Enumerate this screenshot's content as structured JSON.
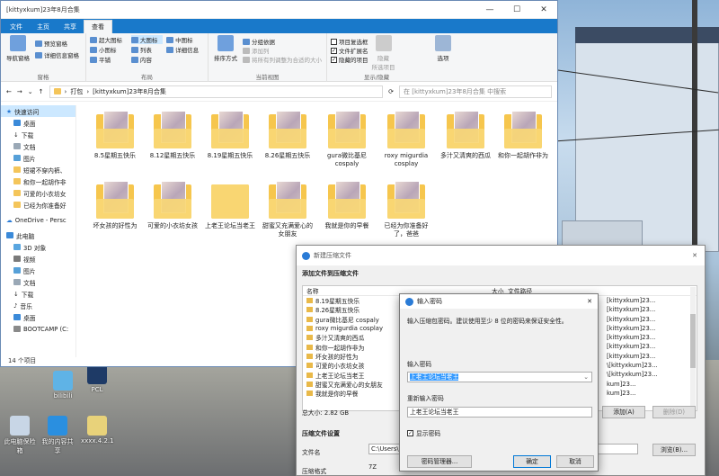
{
  "explorer": {
    "title": "[kittyxkum]23年8月合集",
    "tabs": [
      "文件",
      "主页",
      "共享",
      "查看"
    ],
    "ribbon": {
      "pane": {
        "nav_pane": "导航窗格",
        "preview": "预览窗格",
        "details": "详细信息窗格",
        "label": "窗格"
      },
      "layout": {
        "items": [
          "超大图标",
          "大图标",
          "中图标",
          "小图标",
          "列表",
          "详细信息",
          "平铺",
          "内容"
        ],
        "label": "布局"
      },
      "view": {
        "sort": "排序方式",
        "group": "分组依据",
        "add_column": "添加列",
        "fit_columns": "将所有列调整为合适的大小",
        "label": "当前视图"
      },
      "showhide": {
        "item_checkbox": "项目复选框",
        "extensions": "文件扩展名",
        "hidden_items": "隐藏的项目",
        "hide_selected": "隐藏\n所选项目",
        "options": "选项",
        "label": "显示/隐藏"
      }
    },
    "address": {
      "crumbs": [
        "打包",
        "[kittyxkum]23年8月合集"
      ],
      "search_placeholder": "在 [kittyxkum]23年8月合集 中搜索"
    },
    "nav": [
      "快速访问",
      "桌面",
      "下载",
      "文档",
      "图片",
      "短裙不穿内裤、",
      "和你一起胡作非",
      "可爱的小衣坊女",
      "已经为你准备好",
      "OneDrive - Persc",
      "此电脑",
      "3D 对象",
      "视频",
      "图片",
      "文档",
      "下载",
      "音乐",
      "桌面",
      "BOOTCAMP (C:"
    ],
    "folders": [
      "8.5星期五快乐",
      "8.12星期五快乐",
      "8.19星期五快乐",
      "8.26星期五快乐",
      "gura微比基尼cospaly",
      "roxy migurdia cosplay",
      "多汁又清爽的西瓜",
      "和你一起胡作非为",
      "坏女孩的好性为",
      "可爱的小衣坊女孩",
      "上老王论坛当老王",
      "甜蜜又充满爱心的女朋友",
      "我就是你的早餐",
      "已经为你准备好了，爸爸"
    ],
    "status": "14 个项目"
  },
  "desktop_icons": [
    "PCL",
    "bilibili",
    "此电脑保险箱",
    "我的内容共享",
    "xxxx.4.2.1"
  ],
  "compress": {
    "title": "新建压缩文件",
    "section_add": "添加文件到压缩文件",
    "col_name": "名称",
    "col_size": "大小",
    "col_path": "文件路径",
    "files": [
      "8.19星期五快乐",
      "8.26星期五快乐",
      "gura微比基尼 cospaly",
      "roxy migurdia cosplay",
      "多汁又清爽的西瓜",
      "和你一起胡作非为",
      "坏女孩的好性为",
      "可爱的小衣坊女孩",
      "上老王论坛当老王",
      "甜蜜又充满爱心的女朋友",
      "我就是你的早餐"
    ],
    "path_prefix": "[kittyxkum]23...",
    "path_stub": "\\[kittyxkum]23...",
    "path_partial": "kum]23...",
    "total_size": "总大小: 2.82 GB",
    "add_btn": "添加(A)",
    "delete_btn": "删除(D)",
    "section_settings": "压缩文件设置",
    "filename_label": "文件名",
    "filename_value": "C:\\Users\\d",
    "browse_btn": "浏览(B)...",
    "format_label": "压缩格式",
    "format_value": "7Z"
  },
  "password": {
    "title": "输入密码",
    "desc": "输入压缩包密码。建议使用至少 8 位的密码来保证安全性。",
    "enter_label": "输入密码",
    "enter_value": "上老王论坛当老王",
    "reenter_label": "重新输入密码",
    "reenter_value": "上老王论坛当老王",
    "show_label": "显示密码",
    "manager_btn": "密码管理器...",
    "ok_btn": "确定",
    "cancel_btn": "取消"
  }
}
